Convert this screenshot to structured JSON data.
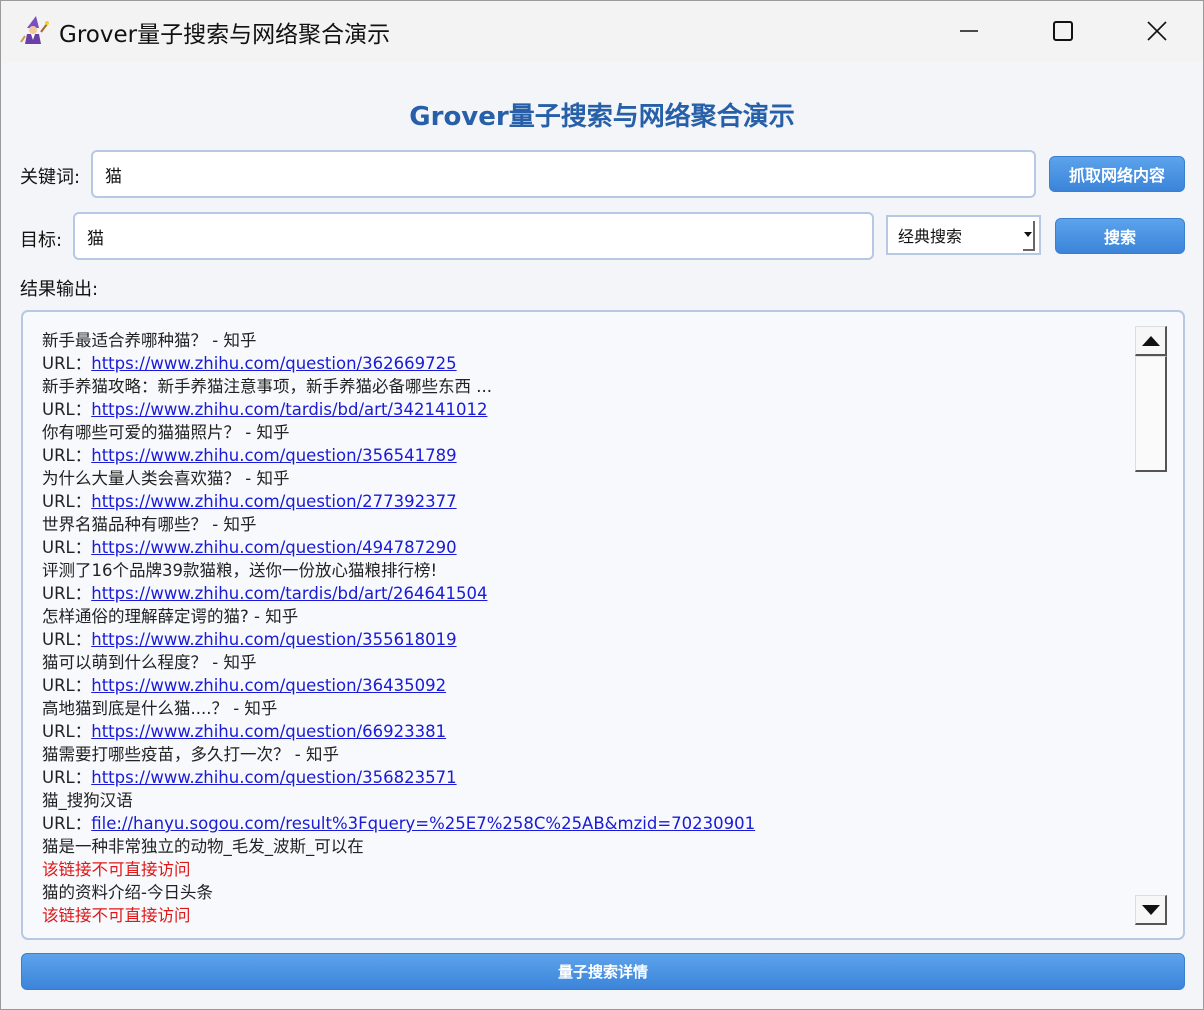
{
  "window": {
    "title": "Grover量子搜索与网络聚合演示",
    "icon": "wizard-icon"
  },
  "heading": "Grover量子搜索与网络聚合演示",
  "keyword": {
    "label": "关键词:",
    "value": "猫",
    "fetch_button": "抓取网络内容"
  },
  "target": {
    "label": "目标:",
    "value": "猫",
    "mode_selected": "经典搜索",
    "search_button": "搜索"
  },
  "results": {
    "label": "结果输出:",
    "lines": [
      {
        "prefix": "",
        "text": "新手最适合养哪种猫？ - 知乎",
        "type": "text"
      },
      {
        "prefix": "URL：",
        "text": "https://www.zhihu.com/question/362669725",
        "type": "url"
      },
      {
        "prefix": "",
        "text": "新手养猫攻略：新手养猫注意事项，新手养猫必备哪些东西 ...",
        "type": "text"
      },
      {
        "prefix": "URL：",
        "text": "https://www.zhihu.com/tardis/bd/art/342141012",
        "type": "url"
      },
      {
        "prefix": "",
        "text": "你有哪些可爱的猫猫照片？ - 知乎",
        "type": "text"
      },
      {
        "prefix": "URL：",
        "text": "https://www.zhihu.com/question/356541789",
        "type": "url"
      },
      {
        "prefix": "",
        "text": "为什么大量人类会喜欢猫？ - 知乎",
        "type": "text"
      },
      {
        "prefix": "URL：",
        "text": "https://www.zhihu.com/question/277392377",
        "type": "url"
      },
      {
        "prefix": "",
        "text": "世界名猫品种有哪些？ - 知乎",
        "type": "text"
      },
      {
        "prefix": "URL：",
        "text": "https://www.zhihu.com/question/494787290",
        "type": "url"
      },
      {
        "prefix": "",
        "text": "评测了16个品牌39款猫粮，送你一份放心猫粮排行榜!",
        "type": "text"
      },
      {
        "prefix": "URL：",
        "text": "https://www.zhihu.com/tardis/bd/art/264641504",
        "type": "url"
      },
      {
        "prefix": "",
        "text": "怎样通俗的理解薛定谔的猫? - 知乎",
        "type": "text"
      },
      {
        "prefix": "URL：",
        "text": "https://www.zhihu.com/question/355618019",
        "type": "url"
      },
      {
        "prefix": "",
        "text": "猫可以萌到什么程度？ - 知乎",
        "type": "text"
      },
      {
        "prefix": "URL：",
        "text": "https://www.zhihu.com/question/36435092",
        "type": "url"
      },
      {
        "prefix": "",
        "text": "高地猫到底是什么猫....？ - 知乎",
        "type": "text"
      },
      {
        "prefix": "URL：",
        "text": "https://www.zhihu.com/question/66923381",
        "type": "url"
      },
      {
        "prefix": "",
        "text": "猫需要打哪些疫苗，多久打一次？ - 知乎",
        "type": "text"
      },
      {
        "prefix": "URL：",
        "text": "https://www.zhihu.com/question/356823571",
        "type": "url"
      },
      {
        "prefix": "",
        "text": "猫_搜狗汉语",
        "type": "text"
      },
      {
        "prefix": "URL：",
        "text": "file://hanyu.sogou.com/result%3Fquery=%25E7%258C%25AB&mzid=70230901",
        "type": "url"
      },
      {
        "prefix": "",
        "text": "猫是一种非常独立的动物_毛发_波斯_可以在",
        "type": "text"
      },
      {
        "prefix": "",
        "text": "该链接不可直接访问",
        "type": "error"
      },
      {
        "prefix": "",
        "text": "猫的资料介绍-今日头条",
        "type": "text"
      },
      {
        "prefix": "",
        "text": "该链接不可直接访问",
        "type": "error"
      }
    ]
  },
  "details_button": "量子搜索详情",
  "colors": {
    "heading": "#2760a8",
    "link": "#1a1ad9",
    "error": "#e01818",
    "button": "#4a91e2"
  }
}
